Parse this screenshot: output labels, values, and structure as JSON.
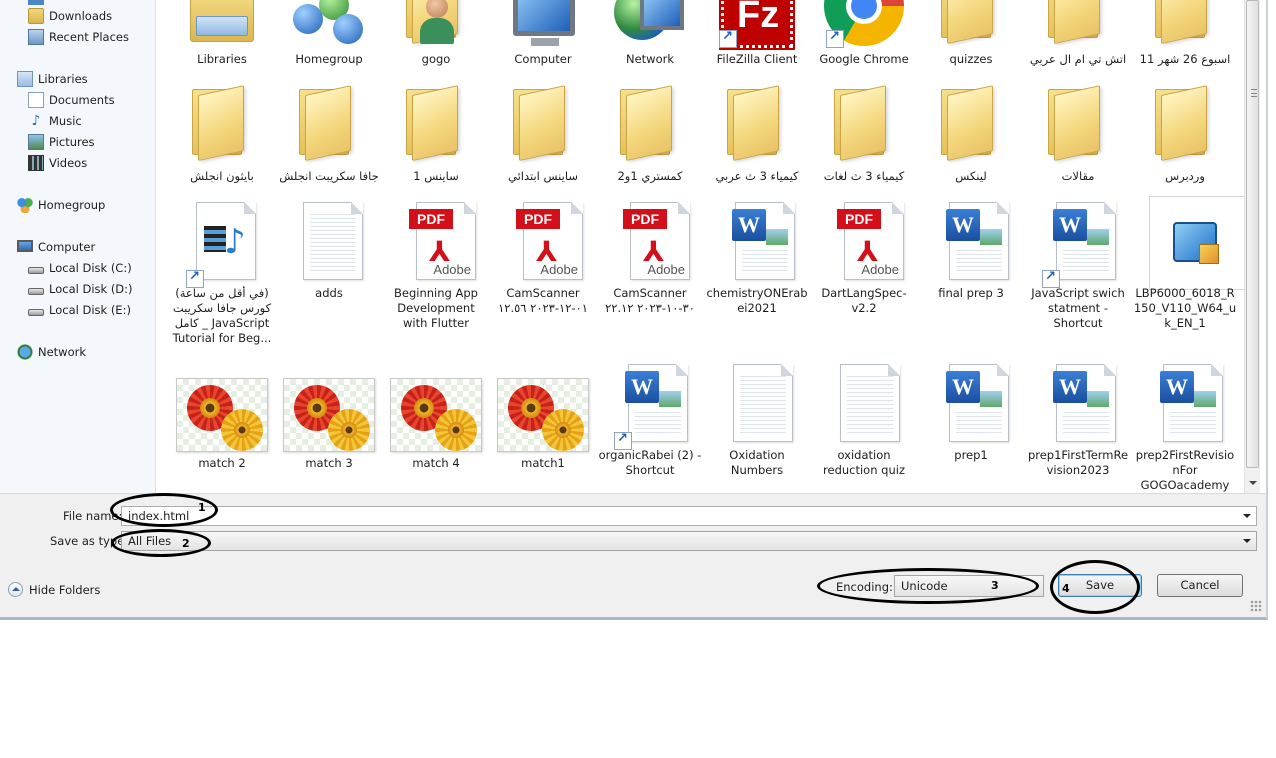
{
  "sidebar": {
    "items": [
      {
        "label": "Downloads",
        "icon": "downloads-icon"
      },
      {
        "label": "Recent Places",
        "icon": "recent-places-icon"
      },
      {
        "label": "Libraries",
        "icon": "libraries-icon"
      },
      {
        "label": "Documents",
        "icon": "documents-icon"
      },
      {
        "label": "Music",
        "icon": "music-icon"
      },
      {
        "label": "Pictures",
        "icon": "pictures-icon"
      },
      {
        "label": "Videos",
        "icon": "videos-icon"
      },
      {
        "label": "Homegroup",
        "icon": "homegroup-icon"
      },
      {
        "label": "Computer",
        "icon": "computer-icon"
      },
      {
        "label": "Local Disk (C:)",
        "icon": "drive-icon"
      },
      {
        "label": "Local Disk (D:)",
        "icon": "drive-icon"
      },
      {
        "label": "Local Disk (E:)",
        "icon": "drive-icon"
      },
      {
        "label": "Network",
        "icon": "network-icon"
      }
    ]
  },
  "files": {
    "row1": [
      {
        "label": "Libraries",
        "kind": "libraries"
      },
      {
        "label": "Homegroup",
        "kind": "homegroup"
      },
      {
        "label": "gogo",
        "kind": "user-folder"
      },
      {
        "label": "Computer",
        "kind": "computer"
      },
      {
        "label": "Network",
        "kind": "network"
      },
      {
        "label": "FileZilla Client",
        "kind": "filezilla"
      },
      {
        "label": "Google Chrome",
        "kind": "chrome"
      },
      {
        "label": "quizzes",
        "kind": "folder"
      },
      {
        "label": "اتش تي ام ال عربي",
        "kind": "folder"
      },
      {
        "label": "اسبوع 26 شهر 11",
        "kind": "folder"
      }
    ],
    "row2": [
      {
        "label": "بايثون انجلش",
        "kind": "folder"
      },
      {
        "label": "جافا سكريبت انجلش",
        "kind": "folder"
      },
      {
        "label": "ساينس 1",
        "kind": "folder"
      },
      {
        "label": "ساينس ابتدائي",
        "kind": "folder"
      },
      {
        "label": "كمستري 1و2",
        "kind": "folder"
      },
      {
        "label": "كيمياء 3 ث عربي",
        "kind": "folder"
      },
      {
        "label": "كيمياء 3 ث لغات",
        "kind": "folder"
      },
      {
        "label": "لينكس",
        "kind": "folder"
      },
      {
        "label": "مقالات",
        "kind": "folder"
      },
      {
        "label": "وردبرس",
        "kind": "folder"
      }
    ],
    "row3": [
      {
        "label": "(في أقل من ساعة) كورس جافا سكريبت كامل _ JavaScript Tutorial for Beg...",
        "kind": "video"
      },
      {
        "label": "adds",
        "kind": "doc"
      },
      {
        "label": "Beginning App Development with Flutter",
        "kind": "pdf"
      },
      {
        "label": "CamScanner ٠١-١٢-٢٠٢٣ ١٢.٥٦",
        "kind": "pdf"
      },
      {
        "label": "CamScanner ٣٠-١٠-٢٠٢٣ ٢٢.١٢",
        "kind": "pdf"
      },
      {
        "label": "chemistryONErabei2021",
        "kind": "word"
      },
      {
        "label": "DartLangSpec-v2.2",
        "kind": "pdf"
      },
      {
        "label": "final prep 3",
        "kind": "word"
      },
      {
        "label": "JavaScript swich statment - Shortcut",
        "kind": "word-shortcut"
      },
      {
        "label": "LBP6000_6018_R150_V110_W64_uk_EN_1",
        "kind": "installer"
      }
    ],
    "row4": [
      {
        "label": "match 2",
        "kind": "image"
      },
      {
        "label": "match 3",
        "kind": "image"
      },
      {
        "label": "match 4",
        "kind": "image"
      },
      {
        "label": "match1",
        "kind": "image"
      },
      {
        "label": "organicRabei (2) - Shortcut",
        "kind": "word-shortcut"
      },
      {
        "label": "Oxidation Numbers",
        "kind": "doc"
      },
      {
        "label": "oxidation reduction quiz",
        "kind": "doc"
      },
      {
        "label": "prep1",
        "kind": "word"
      },
      {
        "label": "prep1FirstTermRevision2023",
        "kind": "word"
      },
      {
        "label": "prep2FirstRevisionFor GOGOacademy",
        "kind": "word"
      }
    ]
  },
  "form": {
    "file_name_label": "File name:",
    "file_name_value": "index.html",
    "save_type_label": "Save as type:",
    "save_type_value": "All Files",
    "encoding_label": "Encoding:",
    "encoding_value": "Unicode",
    "hide_folders_label": "Hide Folders",
    "save_label": "Save",
    "cancel_label": "Cancel"
  },
  "annotations": {
    "n1": "1",
    "n2": "2",
    "n3": "3",
    "n4": "4"
  }
}
